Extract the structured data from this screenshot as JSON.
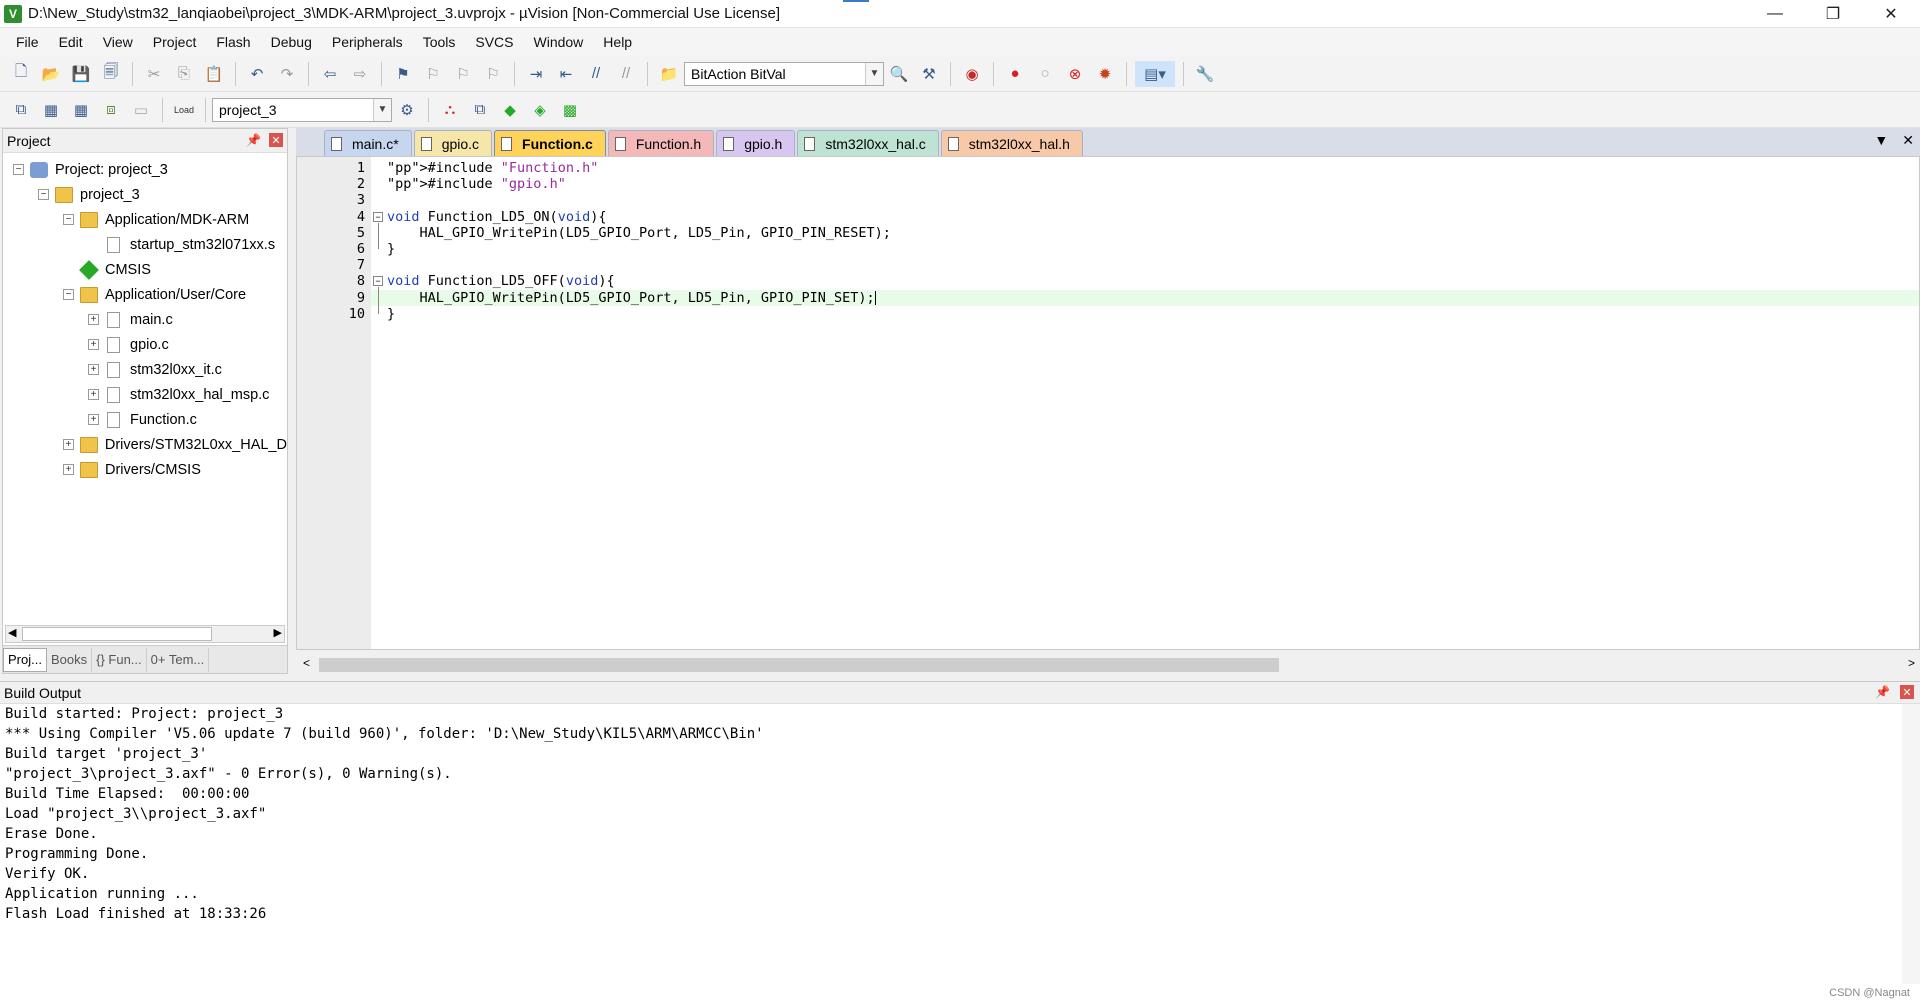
{
  "window": {
    "title": "D:\\New_Study\\stm32_lanqiaobei\\project_3\\MDK-ARM\\project_3.uvprojx - µVision  [Non-Commercial Use License]",
    "app_icon": "V"
  },
  "menu": [
    "File",
    "Edit",
    "View",
    "Project",
    "Flash",
    "Debug",
    "Peripherals",
    "Tools",
    "SVCS",
    "Window",
    "Help"
  ],
  "toolbar": {
    "find_combo": "BitAction BitVal",
    "target_combo": "project_3",
    "load_label": "Load"
  },
  "project_panel": {
    "title": "Project",
    "tree": [
      {
        "label": "Project: project_3",
        "level": 0,
        "exp": "−",
        "icon": "project"
      },
      {
        "label": "project_3",
        "level": 1,
        "exp": "−",
        "icon": "target"
      },
      {
        "label": "Application/MDK-ARM",
        "level": 2,
        "exp": "−",
        "icon": "folder"
      },
      {
        "label": "startup_stm32l071xx.s",
        "level": 3,
        "exp": "",
        "icon": "file"
      },
      {
        "label": "CMSIS",
        "level": 2,
        "exp": "",
        "icon": "gem"
      },
      {
        "label": "Application/User/Core",
        "level": 2,
        "exp": "−",
        "icon": "folder"
      },
      {
        "label": "main.c",
        "level": 3,
        "exp": "+",
        "icon": "file"
      },
      {
        "label": "gpio.c",
        "level": 3,
        "exp": "+",
        "icon": "file"
      },
      {
        "label": "stm32l0xx_it.c",
        "level": 3,
        "exp": "+",
        "icon": "file"
      },
      {
        "label": "stm32l0xx_hal_msp.c",
        "level": 3,
        "exp": "+",
        "icon": "file"
      },
      {
        "label": "Function.c",
        "level": 3,
        "exp": "+",
        "icon": "file"
      },
      {
        "label": "Drivers/STM32L0xx_HAL_D",
        "level": 2,
        "exp": "+",
        "icon": "folder"
      },
      {
        "label": "Drivers/CMSIS",
        "level": 2,
        "exp": "+",
        "icon": "folder"
      }
    ],
    "tabs": [
      "Proj...",
      "Books",
      "{} Fun...",
      "0+ Tem..."
    ]
  },
  "editor": {
    "tabs": [
      {
        "label": "main.c*",
        "color": "#c7d6ef",
        "active": false
      },
      {
        "label": "gpio.c",
        "color": "#f6e7a8",
        "active": false
      },
      {
        "label": "Function.c",
        "color": "#ffd35a",
        "active": true
      },
      {
        "label": "Function.h",
        "color": "#f5b8b8",
        "active": false
      },
      {
        "label": "gpio.h",
        "color": "#d7c7f0",
        "active": false
      },
      {
        "label": "stm32l0xx_hal.c",
        "color": "#bfe3d2",
        "active": false
      },
      {
        "label": "stm32l0xx_hal.h",
        "color": "#f7c9a8",
        "active": false
      }
    ],
    "lines": [
      {
        "n": "1",
        "text": "#include \"Function.h\""
      },
      {
        "n": "2",
        "text": "#include \"gpio.h\""
      },
      {
        "n": "3",
        "text": ""
      },
      {
        "n": "4",
        "text": "void Function_LD5_ON(void){"
      },
      {
        "n": "5",
        "text": "    HAL_GPIO_WritePin(LD5_GPIO_Port, LD5_Pin, GPIO_PIN_RESET);"
      },
      {
        "n": "6",
        "text": "}"
      },
      {
        "n": "7",
        "text": ""
      },
      {
        "n": "8",
        "text": "void Function_LD5_OFF(void){"
      },
      {
        "n": "9",
        "text": "    HAL_GPIO_WritePin(LD5_GPIO_Port, LD5_Pin, GPIO_PIN_SET);"
      },
      {
        "n": "10",
        "text": "}"
      }
    ]
  },
  "build_output": {
    "title": "Build Output",
    "lines": [
      "Build started: Project: project_3",
      "*** Using Compiler 'V5.06 update 7 (build 960)', folder: 'D:\\New_Study\\KIL5\\ARM\\ARMCC\\Bin'",
      "Build target 'project_3'",
      "\"project_3\\project_3.axf\" - 0 Error(s), 0 Warning(s).",
      "Build Time Elapsed:  00:00:00",
      "Load \"project_3\\\\project_3.axf\"",
      "Erase Done.",
      "Programming Done.",
      "Verify OK.",
      "Application running ...",
      "Flash Load finished at 18:33:26"
    ]
  },
  "watermark": "CSDN @Nagnat"
}
